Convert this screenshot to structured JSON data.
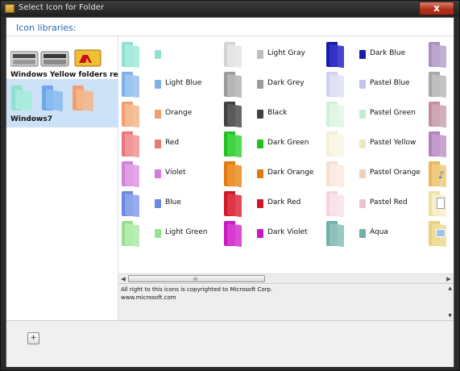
{
  "window": {
    "title": "Select Icon for Folder",
    "close_glyph": "x"
  },
  "header": {
    "label": "Icon libraries:"
  },
  "libraries": [
    {
      "label": "Windows Yellow folders reborn",
      "selected": false
    },
    {
      "label": "Windows7",
      "selected": true
    }
  ],
  "icons": [
    {
      "label": "",
      "color": "#8fe0d0"
    },
    {
      "label": "Light Blue",
      "color": "#7fb0e8"
    },
    {
      "label": "Orange",
      "color": "#f0a070"
    },
    {
      "label": "Red",
      "color": "#e87878"
    },
    {
      "label": "Violet",
      "color": "#d080d8"
    },
    {
      "label": "Blue",
      "color": "#6a88e0"
    },
    {
      "label": "Light Green",
      "color": "#98e090"
    },
    {
      "label": "Light Gray",
      "color": "#d4d4d4"
    },
    {
      "label": "Dark Grey",
      "color": "#9a9a9a"
    },
    {
      "label": "Black",
      "color": "#404040"
    },
    {
      "label": "Dark Green",
      "color": "#20c020"
    },
    {
      "label": "Dark Orange",
      "color": "#e07a10"
    },
    {
      "label": "Dark Red",
      "color": "#d01828"
    },
    {
      "label": "Dark Violet",
      "color": "#c818c0"
    },
    {
      "label": "Dark Blue",
      "color": "#1a1ab0"
    },
    {
      "label": "Pastel Blue",
      "color": "#d0d0f0"
    },
    {
      "label": "Pastel Green",
      "color": "#d0f0d8"
    },
    {
      "label": "Pastel Yellow",
      "color": "#f4f0d4"
    },
    {
      "label": "Pastel Orange",
      "color": "#f4e0d0"
    },
    {
      "label": "Pastel Red",
      "color": "#f4d4dc"
    },
    {
      "label": "Aqua",
      "color": "#70b0a8"
    }
  ],
  "partial_column": [
    "#a890c0",
    "#a8a8a8",
    "#c090a0",
    "#b080b8",
    "#e8b860",
    "#f0e0a0",
    "#e8d080"
  ],
  "description": {
    "line1": "All right to this icons is copyrighted to Microsoft Corp.",
    "line2": "www.microsoft.com"
  },
  "bottom": {
    "add_label": "+"
  },
  "scroll_grip": "III"
}
